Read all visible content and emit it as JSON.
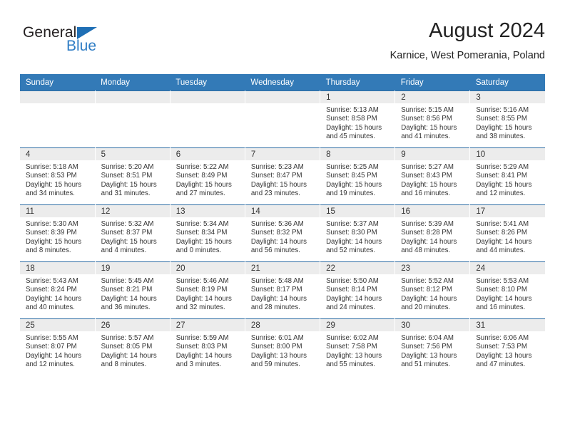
{
  "brand": {
    "line1": "General",
    "line2": "Blue",
    "triangle_color": "#1f6fb5",
    "blue_color": "#2e7cc4"
  },
  "header": {
    "title": "August 2024",
    "subtitle": "Karnice, West Pomerania, Poland"
  },
  "theme": {
    "header_bg": "#337ab7",
    "daynum_bg": "#ececec",
    "row_border": "#2e6da4"
  },
  "weekday_headers": [
    "Sunday",
    "Monday",
    "Tuesday",
    "Wednesday",
    "Thursday",
    "Friday",
    "Saturday"
  ],
  "weeks": [
    [
      {
        "day": "",
        "lines": []
      },
      {
        "day": "",
        "lines": []
      },
      {
        "day": "",
        "lines": []
      },
      {
        "day": "",
        "lines": []
      },
      {
        "day": "1",
        "lines": [
          "Sunrise: 5:13 AM",
          "Sunset: 8:58 PM",
          "Daylight: 15 hours",
          "and 45 minutes."
        ]
      },
      {
        "day": "2",
        "lines": [
          "Sunrise: 5:15 AM",
          "Sunset: 8:56 PM",
          "Daylight: 15 hours",
          "and 41 minutes."
        ]
      },
      {
        "day": "3",
        "lines": [
          "Sunrise: 5:16 AM",
          "Sunset: 8:55 PM",
          "Daylight: 15 hours",
          "and 38 minutes."
        ]
      }
    ],
    [
      {
        "day": "4",
        "lines": [
          "Sunrise: 5:18 AM",
          "Sunset: 8:53 PM",
          "Daylight: 15 hours",
          "and 34 minutes."
        ]
      },
      {
        "day": "5",
        "lines": [
          "Sunrise: 5:20 AM",
          "Sunset: 8:51 PM",
          "Daylight: 15 hours",
          "and 31 minutes."
        ]
      },
      {
        "day": "6",
        "lines": [
          "Sunrise: 5:22 AM",
          "Sunset: 8:49 PM",
          "Daylight: 15 hours",
          "and 27 minutes."
        ]
      },
      {
        "day": "7",
        "lines": [
          "Sunrise: 5:23 AM",
          "Sunset: 8:47 PM",
          "Daylight: 15 hours",
          "and 23 minutes."
        ]
      },
      {
        "day": "8",
        "lines": [
          "Sunrise: 5:25 AM",
          "Sunset: 8:45 PM",
          "Daylight: 15 hours",
          "and 19 minutes."
        ]
      },
      {
        "day": "9",
        "lines": [
          "Sunrise: 5:27 AM",
          "Sunset: 8:43 PM",
          "Daylight: 15 hours",
          "and 16 minutes."
        ]
      },
      {
        "day": "10",
        "lines": [
          "Sunrise: 5:29 AM",
          "Sunset: 8:41 PM",
          "Daylight: 15 hours",
          "and 12 minutes."
        ]
      }
    ],
    [
      {
        "day": "11",
        "lines": [
          "Sunrise: 5:30 AM",
          "Sunset: 8:39 PM",
          "Daylight: 15 hours",
          "and 8 minutes."
        ]
      },
      {
        "day": "12",
        "lines": [
          "Sunrise: 5:32 AM",
          "Sunset: 8:37 PM",
          "Daylight: 15 hours",
          "and 4 minutes."
        ]
      },
      {
        "day": "13",
        "lines": [
          "Sunrise: 5:34 AM",
          "Sunset: 8:34 PM",
          "Daylight: 15 hours",
          "and 0 minutes."
        ]
      },
      {
        "day": "14",
        "lines": [
          "Sunrise: 5:36 AM",
          "Sunset: 8:32 PM",
          "Daylight: 14 hours",
          "and 56 minutes."
        ]
      },
      {
        "day": "15",
        "lines": [
          "Sunrise: 5:37 AM",
          "Sunset: 8:30 PM",
          "Daylight: 14 hours",
          "and 52 minutes."
        ]
      },
      {
        "day": "16",
        "lines": [
          "Sunrise: 5:39 AM",
          "Sunset: 8:28 PM",
          "Daylight: 14 hours",
          "and 48 minutes."
        ]
      },
      {
        "day": "17",
        "lines": [
          "Sunrise: 5:41 AM",
          "Sunset: 8:26 PM",
          "Daylight: 14 hours",
          "and 44 minutes."
        ]
      }
    ],
    [
      {
        "day": "18",
        "lines": [
          "Sunrise: 5:43 AM",
          "Sunset: 8:24 PM",
          "Daylight: 14 hours",
          "and 40 minutes."
        ]
      },
      {
        "day": "19",
        "lines": [
          "Sunrise: 5:45 AM",
          "Sunset: 8:21 PM",
          "Daylight: 14 hours",
          "and 36 minutes."
        ]
      },
      {
        "day": "20",
        "lines": [
          "Sunrise: 5:46 AM",
          "Sunset: 8:19 PM",
          "Daylight: 14 hours",
          "and 32 minutes."
        ]
      },
      {
        "day": "21",
        "lines": [
          "Sunrise: 5:48 AM",
          "Sunset: 8:17 PM",
          "Daylight: 14 hours",
          "and 28 minutes."
        ]
      },
      {
        "day": "22",
        "lines": [
          "Sunrise: 5:50 AM",
          "Sunset: 8:14 PM",
          "Daylight: 14 hours",
          "and 24 minutes."
        ]
      },
      {
        "day": "23",
        "lines": [
          "Sunrise: 5:52 AM",
          "Sunset: 8:12 PM",
          "Daylight: 14 hours",
          "and 20 minutes."
        ]
      },
      {
        "day": "24",
        "lines": [
          "Sunrise: 5:53 AM",
          "Sunset: 8:10 PM",
          "Daylight: 14 hours",
          "and 16 minutes."
        ]
      }
    ],
    [
      {
        "day": "25",
        "lines": [
          "Sunrise: 5:55 AM",
          "Sunset: 8:07 PM",
          "Daylight: 14 hours",
          "and 12 minutes."
        ]
      },
      {
        "day": "26",
        "lines": [
          "Sunrise: 5:57 AM",
          "Sunset: 8:05 PM",
          "Daylight: 14 hours",
          "and 8 minutes."
        ]
      },
      {
        "day": "27",
        "lines": [
          "Sunrise: 5:59 AM",
          "Sunset: 8:03 PM",
          "Daylight: 14 hours",
          "and 3 minutes."
        ]
      },
      {
        "day": "28",
        "lines": [
          "Sunrise: 6:01 AM",
          "Sunset: 8:00 PM",
          "Daylight: 13 hours",
          "and 59 minutes."
        ]
      },
      {
        "day": "29",
        "lines": [
          "Sunrise: 6:02 AM",
          "Sunset: 7:58 PM",
          "Daylight: 13 hours",
          "and 55 minutes."
        ]
      },
      {
        "day": "30",
        "lines": [
          "Sunrise: 6:04 AM",
          "Sunset: 7:56 PM",
          "Daylight: 13 hours",
          "and 51 minutes."
        ]
      },
      {
        "day": "31",
        "lines": [
          "Sunrise: 6:06 AM",
          "Sunset: 7:53 PM",
          "Daylight: 13 hours",
          "and 47 minutes."
        ]
      }
    ]
  ]
}
